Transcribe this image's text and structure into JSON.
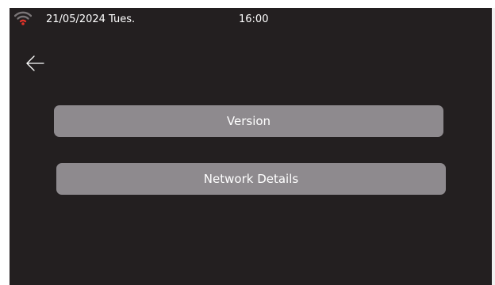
{
  "status_bar": {
    "wifi_icon": "wifi-weak-icon",
    "date": "21/05/2024 Tues.",
    "time": "16:00"
  },
  "navigation": {
    "back_icon": "arrow-left-icon"
  },
  "menu": {
    "items": [
      {
        "label": "Version"
      },
      {
        "label": "Network Details"
      }
    ]
  },
  "colors": {
    "background": "#231f20",
    "button": "#8e8a8e",
    "text": "#ffffff",
    "wifi_active": "#e0332a",
    "wifi_inactive": "#7a7577"
  }
}
